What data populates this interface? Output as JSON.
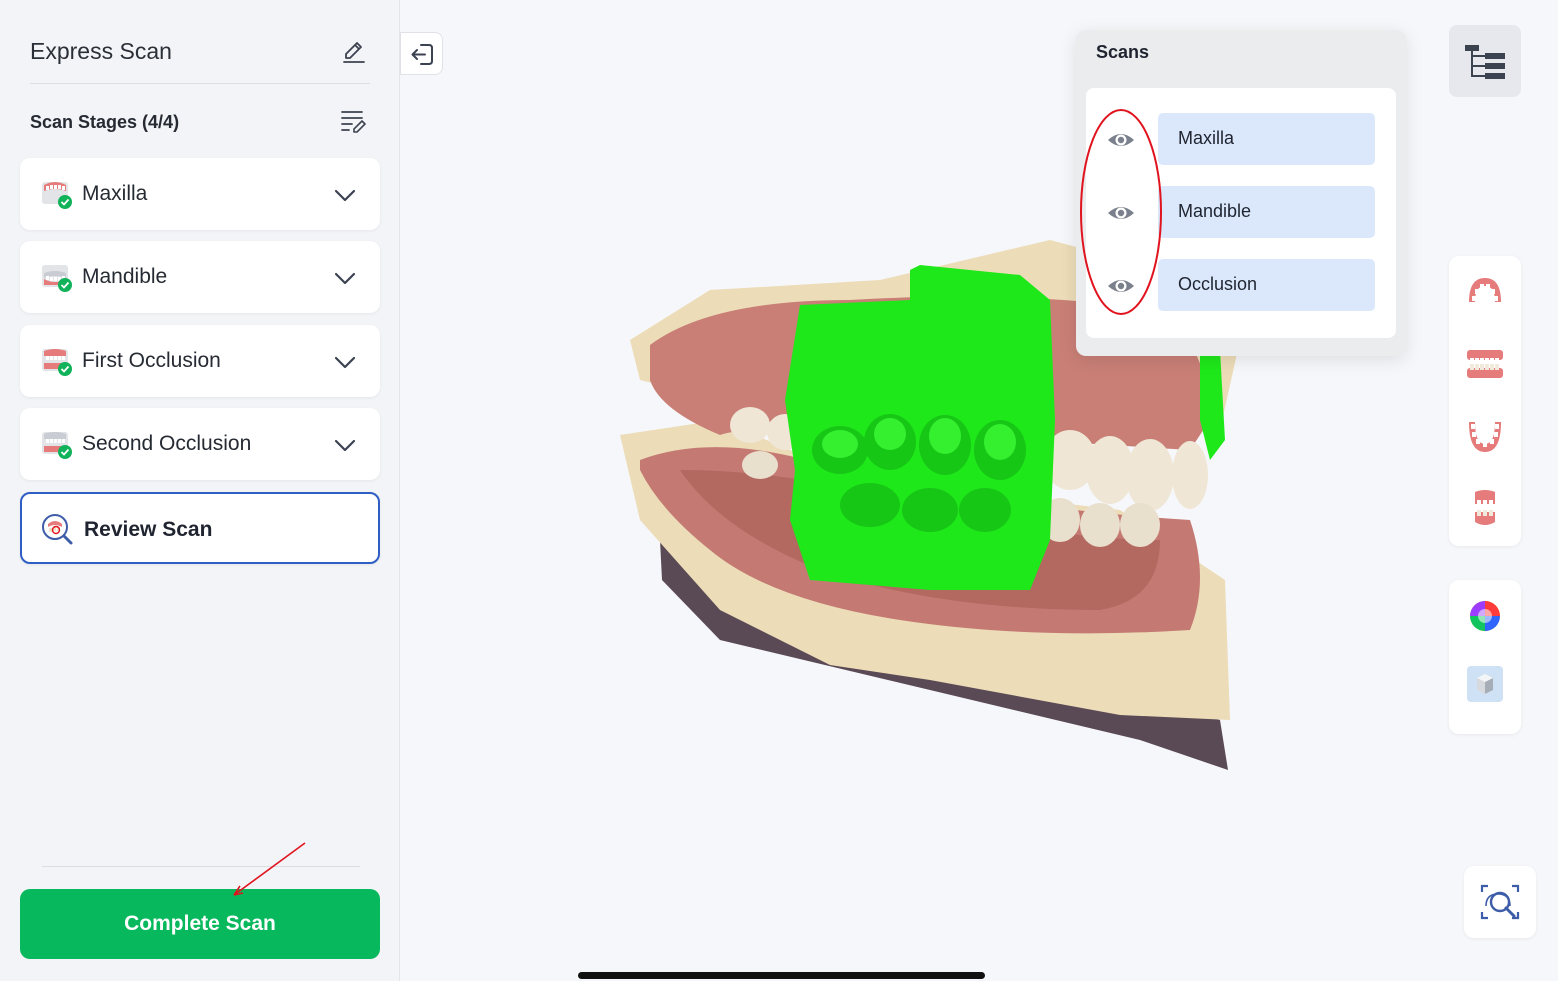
{
  "sidebar": {
    "title": "Express Scan",
    "stages_label": "Scan Stages (4/4)",
    "stages": [
      {
        "label": "Maxilla",
        "icon": "maxilla-stage-icon"
      },
      {
        "label": "Mandible",
        "icon": "mandible-stage-icon"
      },
      {
        "label": "First Occlusion",
        "icon": "occlusion-stage-icon"
      },
      {
        "label": "Second Occlusion",
        "icon": "occlusion-stage-icon"
      }
    ],
    "review": {
      "label": "Review Scan",
      "icon": "review-scan-icon"
    },
    "complete_label": "Complete Scan"
  },
  "scans": {
    "title": "Scans",
    "items": [
      {
        "label": "Maxilla",
        "visible": true
      },
      {
        "label": "Mandible",
        "visible": true
      },
      {
        "label": "Occlusion",
        "visible": true
      }
    ]
  },
  "colors": {
    "accent_green": "#07b85c",
    "selection_blue": "#2f5ec4",
    "chip_blue": "#dbe8fb",
    "annotation_red": "#e0141e",
    "occlusion_green": "#1ee81a"
  }
}
